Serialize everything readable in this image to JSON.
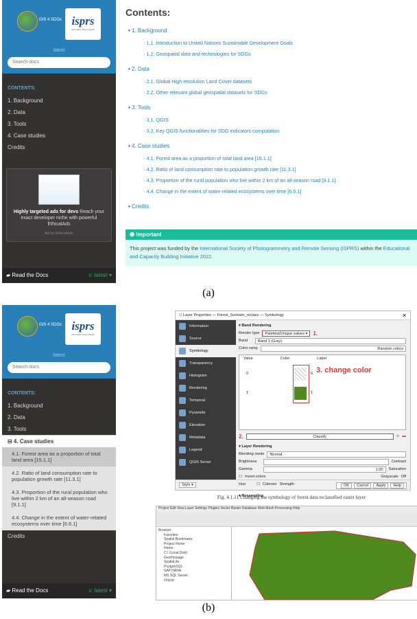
{
  "sidebar": {
    "logo_text": "GIS 4 SDGs",
    "isprs": "isprs",
    "isprs_sub": "Information Fleet Integrity",
    "version": "latest",
    "search_placeholder": "Search docs",
    "contents_caption": "CONTENTS:",
    "nav": [
      "1. Background",
      "2. Data",
      "3. Tools",
      "4. Case studies",
      "Credits"
    ],
    "nav_b_current": "⊟ 4. Case studies",
    "nav_b_sub": [
      "4.1. Forest area as a proportion of total land area [15.1.1]",
      "4.2. Ratio of land consumption rate to population growth rate [11.3.1]",
      "4.3. Proportion of the rural population who live within 2 km of an all-season road [9.1.1]",
      "4.4. Change in the extent of water-related ecosystems over time [6.6.1]"
    ],
    "ad_title": "Highly targeted ads for devs",
    "ad_body": "Reach your exact developer niche with powerful EthicalAds",
    "ad_footer": "Ad by EthicalAds",
    "rtd": "Read the Docs",
    "rtd_version": "v: latest ▾"
  },
  "content": {
    "heading": "Contents:",
    "sections": [
      {
        "title": "1. Background",
        "subs": [
          "1.1. Introduction to United Nations Sustainable Development Goals",
          "1.2. Geospatial data and technologies for SDGs"
        ]
      },
      {
        "title": "2. Data",
        "subs": [
          "2.1. Global High-resolution Land Cover datasets",
          "2.2. Other relevant global geospatial datasets for SDGs"
        ]
      },
      {
        "title": "3. Tools",
        "subs": [
          "3.1. QGIS",
          "3.2. Key QGIS functionalities for SDG indicators computation"
        ]
      },
      {
        "title": "4. Case studies",
        "subs": [
          "4.1. Forest area as a proportion of total land area [15.1.1]",
          "4.2. Ratio of land consumption rate to population growth rate [11.3.1]",
          "4.3. Proportion of the rural population who live within 2 km of an all-season road [9.1.1]",
          "4.4. Change in the extent of water-related ecosystems over time [6.6.1]"
        ]
      },
      {
        "title": "Credits",
        "subs": []
      }
    ],
    "important_title": "Important",
    "important_pre": "This project was funded by the ",
    "important_link1": "International Society of Photogrammetry and Remote Sensing (ISPRS)",
    "important_mid": " within the ",
    "important_link2": "Educational and Capacity Building Initiative 2022",
    "important_post": "."
  },
  "captions": {
    "a": "(a)",
    "b": "(b)"
  },
  "qgis": {
    "title": "Layer Properties — Forest_Surinam_reclass — Symbology",
    "tabs": [
      "Information",
      "Source",
      "Symbology",
      "Transparency",
      "Histogram",
      "Rendering",
      "Temporal",
      "Pyramids",
      "Elevation",
      "Metadata",
      "Legend",
      "QGIS Server"
    ],
    "band_rendering": "▾ Band Rendering",
    "render_type_label": "Render type",
    "render_type": "Paletted/Unique values ▾",
    "band_label": "Band",
    "band": "Band 1 (Gray)",
    "ramp_label": "Color ramp",
    "ramp": "Random colors",
    "cols": [
      "Value",
      "Color",
      "Label"
    ],
    "vals": [
      "0",
      "1"
    ],
    "ann1": "1.",
    "ann2": "2.",
    "ann3": "3. change color",
    "classify": "Classify",
    "layer_rendering": "▾ Layer Rendering",
    "blending": "Blending mode",
    "blending_val": "Normal",
    "brightness": "Brightness",
    "contrast": "Contrast",
    "gamma": "Gamma",
    "gamma_val": "1.00",
    "saturation": "Saturation",
    "invert": "Invert colors",
    "grayscale": "Grayscale",
    "grayscale_val": "Off",
    "hue": "Hue",
    "colorize": "Colorize",
    "strength": "Strength",
    "resampling": "▾ Resampling",
    "style": "Style ▾",
    "buttons": [
      "OK",
      "Cancel",
      "Apply",
      "Help"
    ],
    "fig_caption": "Fig. 4.1.11 Changing the symbology of forest data reclassified raster layer",
    "menu": "Project  Edit  View  Layer  Settings  Plugins  Vector  Raster  Database  Web  Mesh  Processing  Help",
    "browser_title": "Browser",
    "browser_items": [
      "Favorites",
      "Spatial Bookmarks",
      "Project Home",
      "Home",
      "C:\\ (Local Disk)",
      "GeoPackage",
      "SpatiaLite",
      "PostgreSQL",
      "SAP HANA",
      "MS SQL Server",
      "Oracle"
    ],
    "forest_color": "#4e8a1e"
  }
}
